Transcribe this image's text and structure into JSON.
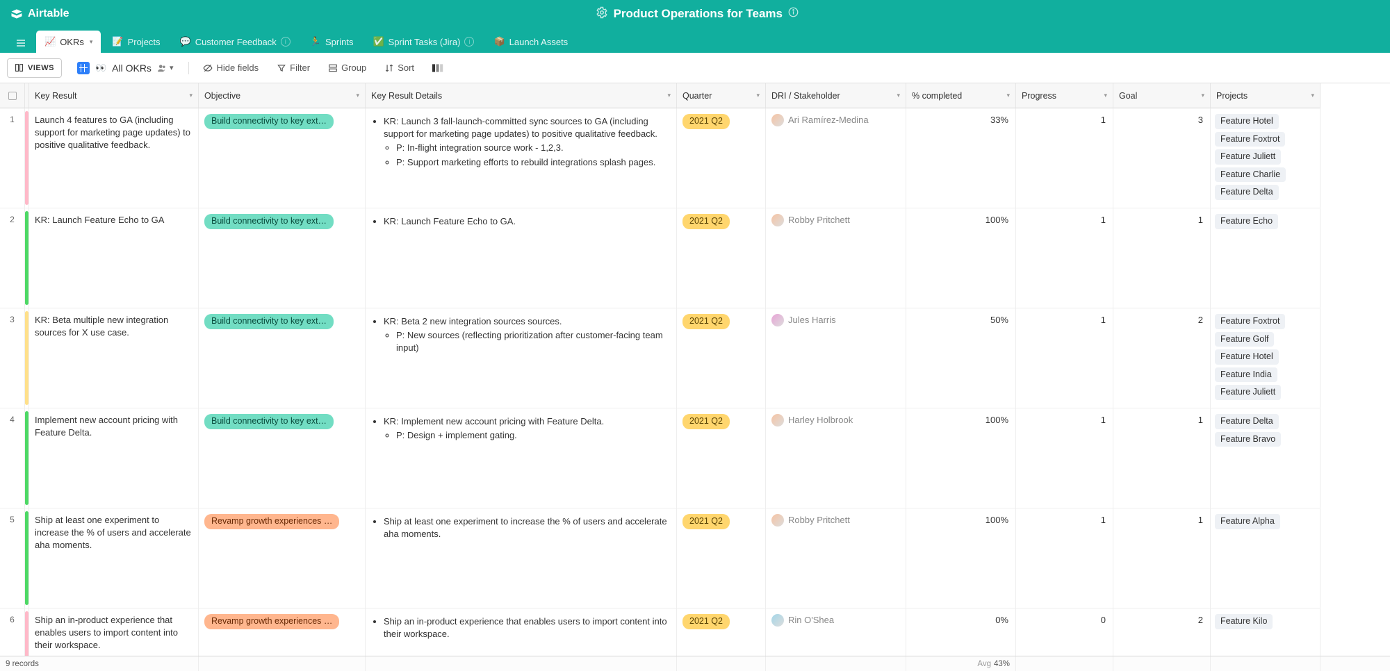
{
  "app": {
    "name": "Airtable",
    "title": "Product Operations for Teams"
  },
  "tabs": [
    {
      "emoji": "📈",
      "label": "OKRs",
      "active": true
    },
    {
      "emoji": "📝",
      "label": "Projects"
    },
    {
      "emoji": "💬",
      "label": "Customer Feedback",
      "info": true
    },
    {
      "emoji": "🏃",
      "label": "Sprints"
    },
    {
      "emoji": "✅",
      "label": "Sprint Tasks (Jira)",
      "info": true
    },
    {
      "emoji": "📦",
      "label": "Launch Assets"
    }
  ],
  "toolbar": {
    "views_label": "VIEWS",
    "view_name": "All OKRs",
    "hide_fields": "Hide fields",
    "filter": "Filter",
    "group": "Group",
    "sort": "Sort"
  },
  "columns": [
    "Key Result",
    "Objective",
    "Key Result Details",
    "Quarter",
    "DRI / Stakeholder",
    "% completed",
    "Progress",
    "Goal",
    "Projects"
  ],
  "rows": [
    {
      "n": 1,
      "bar": "#ffb8c8",
      "kr": "Launch 4 features to GA (including support for marketing page updates) to positive qualitative feedback.",
      "obj": {
        "text": "Build connectivity to key ext…",
        "c": "teal"
      },
      "details": {
        "top": "KR: Launch 3 fall-launch-committed sync sources to GA (including support for marketing page updates) to positive qualitative feedback.",
        "sub": [
          "P: In-flight integration source work - 1,2,3.",
          "P: Support marketing efforts to rebuild integrations splash pages."
        ]
      },
      "quarter": "2021 Q2",
      "dri": {
        "name": "Ari Ramírez-Medina",
        "color": "#f6c3a3"
      },
      "pct": "33%",
      "progress": "1",
      "goal": "3",
      "projects": [
        "Feature Hotel",
        "Feature Foxtrot",
        "Feature Juliett",
        "Feature Charlie",
        "Feature Delta"
      ]
    },
    {
      "n": 2,
      "bar": "#4dd865",
      "kr": "KR: Launch Feature Echo to GA",
      "obj": {
        "text": "Build connectivity to key ext…",
        "c": "teal"
      },
      "details": {
        "top": "KR: Launch Feature Echo to GA.",
        "sub": []
      },
      "quarter": "2021 Q2",
      "dri": {
        "name": "Robby Pritchett",
        "color": "#f6c3a3"
      },
      "pct": "100%",
      "progress": "1",
      "goal": "1",
      "projects": [
        "Feature Echo"
      ]
    },
    {
      "n": 3,
      "bar": "#ffe08a",
      "kr": "KR: Beta multiple new integration sources for X use case.",
      "obj": {
        "text": "Build connectivity to key ext…",
        "c": "teal"
      },
      "details": {
        "top": "KR: Beta 2 new  integration sources sources.",
        "sub": [
          "P:  New sources (reflecting prioritization after customer-facing team input)"
        ]
      },
      "quarter": "2021 Q2",
      "dri": {
        "name": "Jules Harris",
        "color": "#e8a3d6"
      },
      "pct": "50%",
      "progress": "1",
      "goal": "2",
      "projects": [
        "Feature Foxtrot",
        "Feature Golf",
        "Feature Hotel",
        "Feature India",
        "Feature Juliett"
      ]
    },
    {
      "n": 4,
      "bar": "#4dd865",
      "kr": "Implement new account pricing with Feature Delta.",
      "obj": {
        "text": "Build connectivity to key ext…",
        "c": "teal"
      },
      "details": {
        "top": "KR: Implement new account pricing with Feature Delta.",
        "sub": [
          "P: Design + implement gating."
        ]
      },
      "quarter": "2021 Q2",
      "dri": {
        "name": "Harley Holbrook",
        "color": "#f6c3a3"
      },
      "pct": "100%",
      "progress": "1",
      "goal": "1",
      "projects": [
        "Feature Delta",
        "Feature Bravo"
      ]
    },
    {
      "n": 5,
      "bar": "#4dd865",
      "kr": "Ship at least one experiment to increase the % of users and accelerate aha moments.",
      "obj": {
        "text": "Revamp growth experiences …",
        "c": "orange"
      },
      "details": {
        "top": "Ship at least one experiment to increase the % of users and accelerate aha moments.",
        "sub": []
      },
      "quarter": "2021 Q2",
      "dri": {
        "name": "Robby Pritchett",
        "color": "#f6c3a3"
      },
      "pct": "100%",
      "progress": "1",
      "goal": "1",
      "projects": [
        "Feature Alpha"
      ]
    },
    {
      "n": 6,
      "bar": "#ffb8c8",
      "kr": "Ship an in-product experience that enables users to import content into their workspace.",
      "obj": {
        "text": "Revamp growth experiences …",
        "c": "orange"
      },
      "details": {
        "top": "Ship an in-product experience that enables users to import content into their workspace.",
        "sub": []
      },
      "quarter": "2021 Q2",
      "dri": {
        "name": "Rin O'Shea",
        "color": "#a3d6e8"
      },
      "pct": "0%",
      "progress": "0",
      "goal": "2",
      "projects": [
        "Feature Kilo"
      ]
    }
  ],
  "footer": {
    "records": "9 records",
    "avg_label": "Avg",
    "avg_value": "43%"
  }
}
